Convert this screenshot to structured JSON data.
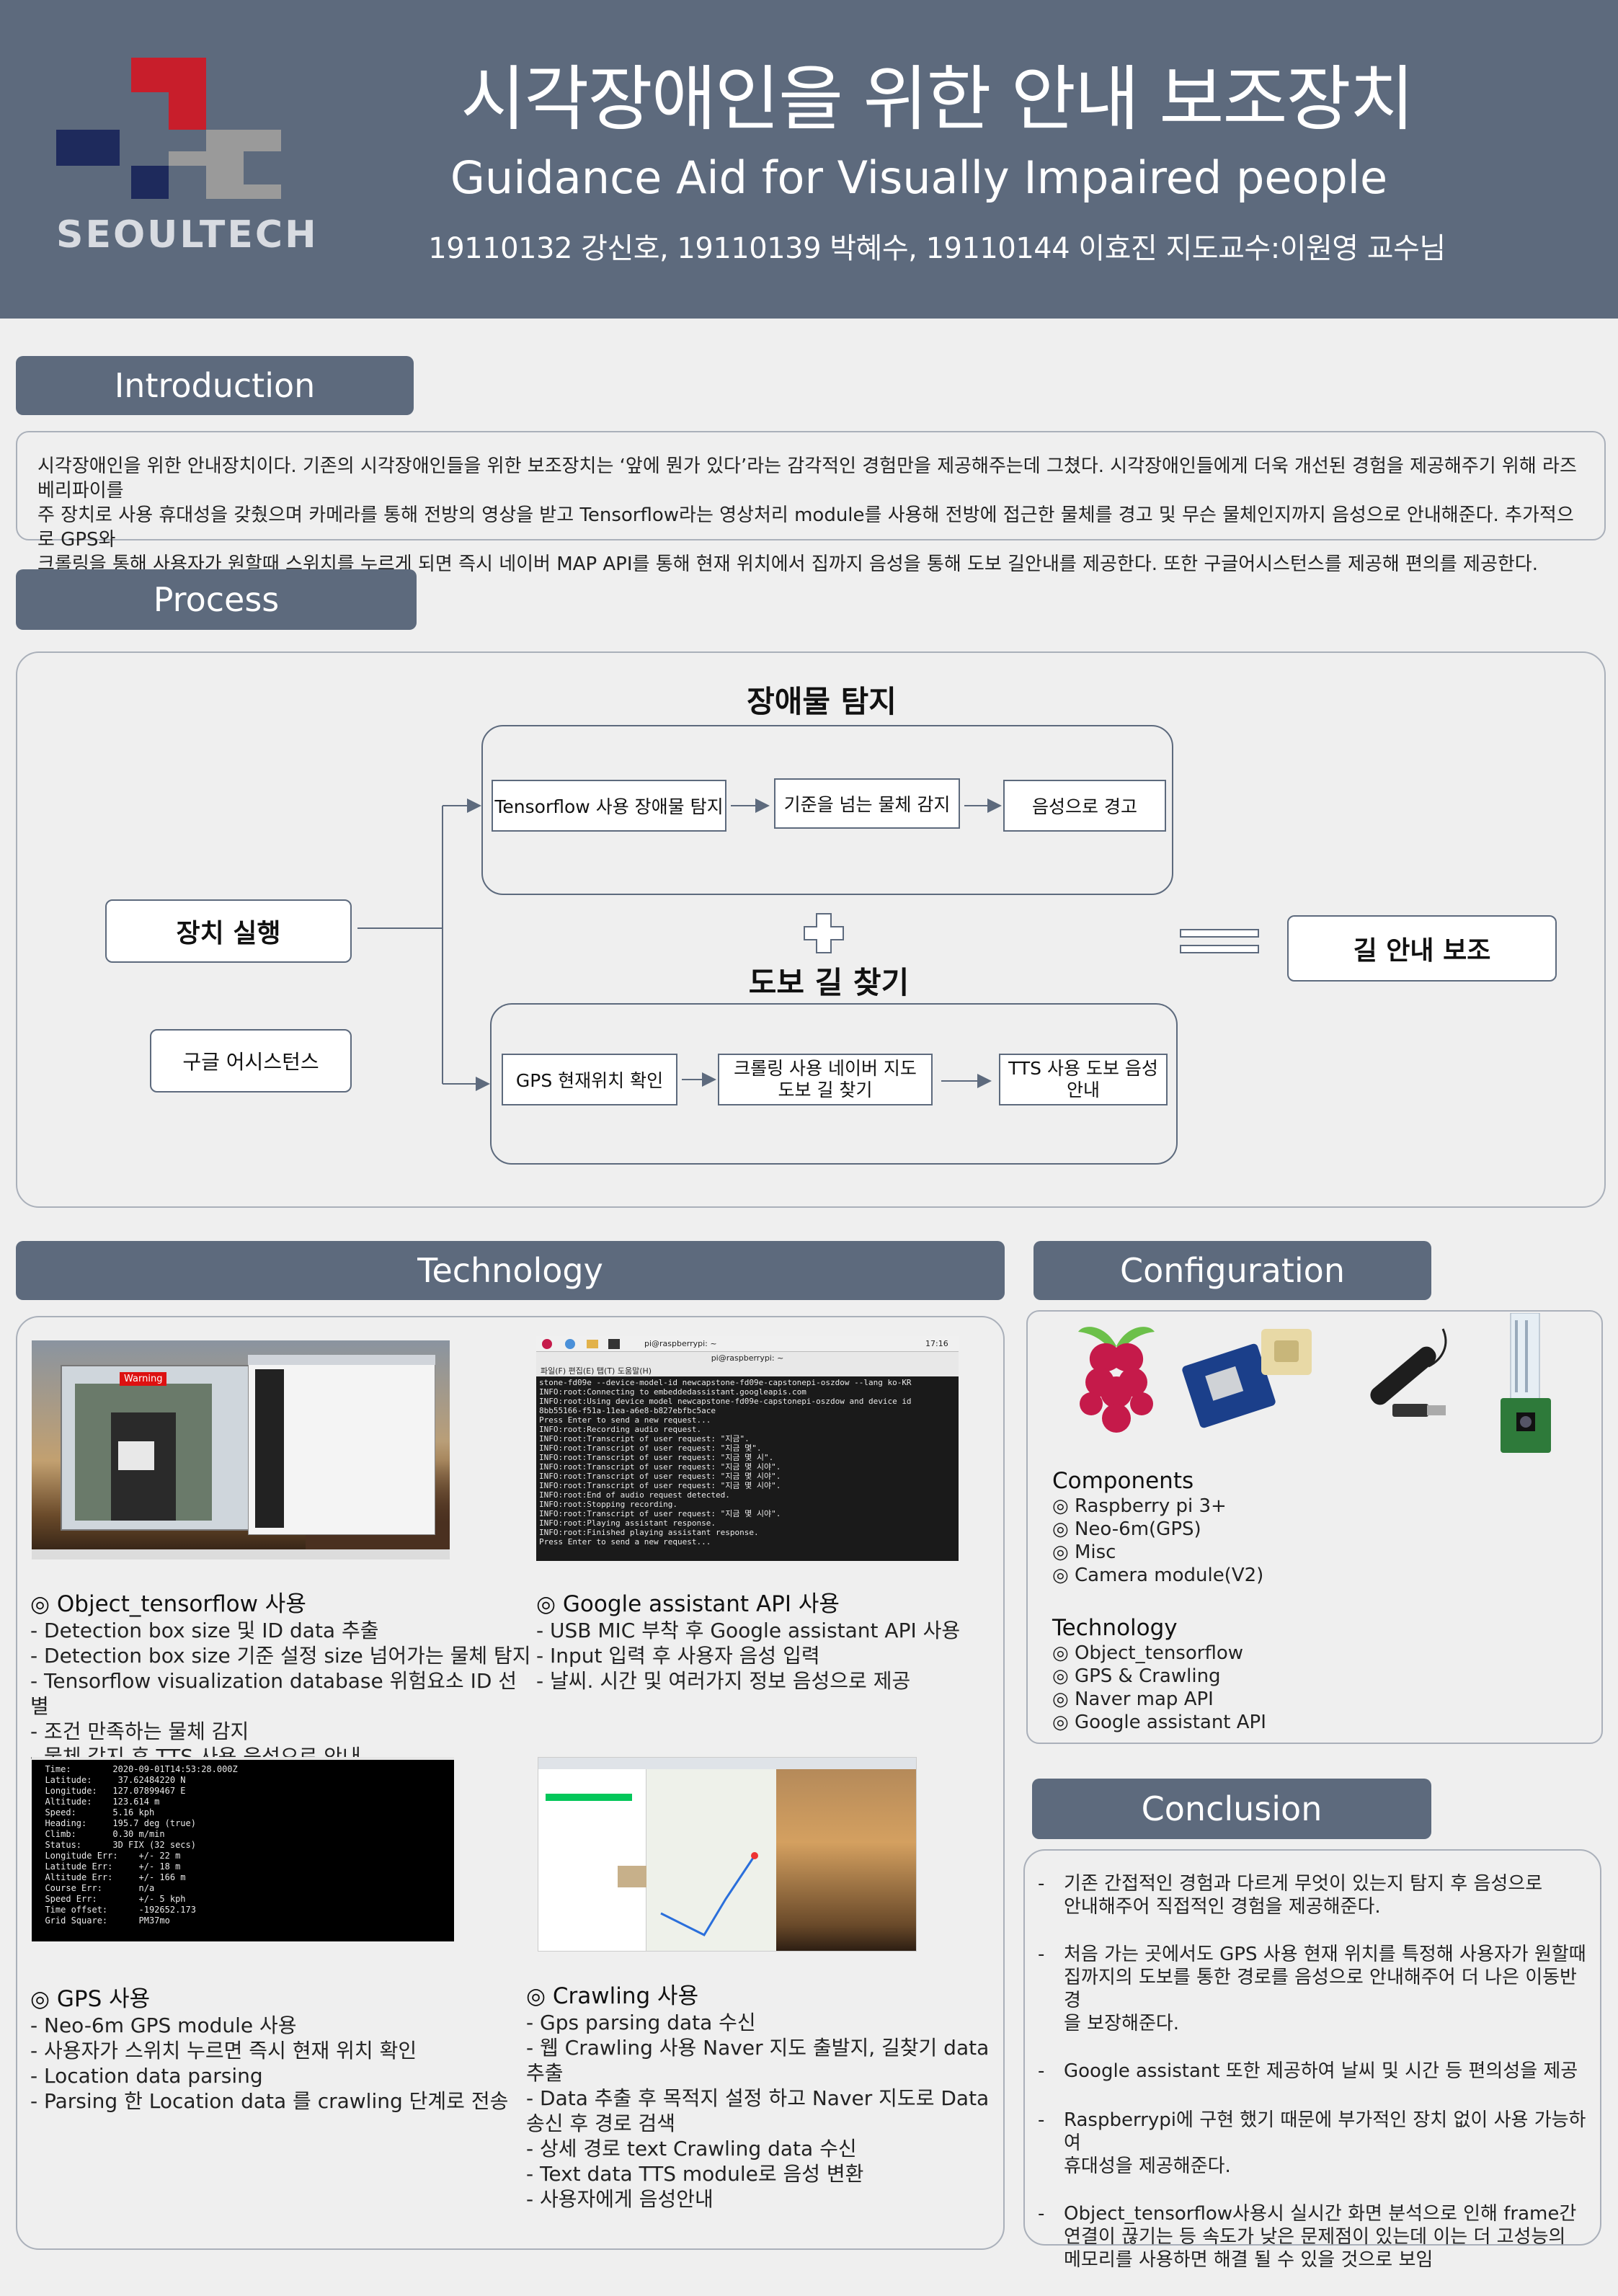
{
  "header": {
    "title": "시각장애인을 위한  안내 보조장치",
    "subtitle": "Guidance Aid for Visually Impaired people",
    "authors": "19110132 강신호, 19110139 박혜수, 19110144 이효진   지도교수:이원영 교수님",
    "logo_text": "SEOULTECH",
    "colors": {
      "header_bg": "#5d6a7d",
      "logo_red": "#c81e2b",
      "logo_navy": "#1e2a5c",
      "logo_gray": "#9a9a9a"
    }
  },
  "introduction": {
    "heading": "Introduction",
    "lines": [
      " 시각장애인을 위한 안내장치이다. 기존의 시각장애인들을 위한 보조장치는 ‘앞에 뭔가 있다’라는 감각적인 경험만을 제공해주는데 그쳤다. 시각장애인들에게 더욱 개선된 경험을 제공해주기 위해 라즈베리파이를",
      "주 장치로 사용 휴대성을 갖췄으며 카메라를 통해 전방의 영상을 받고 Tensorflow라는 영상처리 module를 사용해 전방에 접근한 물체를 경고 및 무슨 물체인지까지 음성으로 안내해준다. 추가적으로 GPS와",
      "크롤링을 통해 사용자가 원할때 스위치를 누르게 되면 즉시 네이버 MAP API를 통해 현재 위치에서 집까지 음성을 통해 도보 길안내를 제공한다. 또한 구글어시스턴스를 제공해 편의를 제공한다."
    ]
  },
  "process": {
    "heading": "Process",
    "obstacle_title": "장애물 탐지",
    "walk_title": "도보 길 찾기",
    "device_run": "장치 실행",
    "google_assistant": "구글 어시스턴스",
    "guide_assist": "길 안내 보조",
    "top_steps": [
      "Tensorflow 사용 장애물 탐지",
      "기준을 넘는 물체 감지",
      "음성으로 경고"
    ],
    "bottom_steps": [
      "GPS 현재위치 확인",
      "크롤링 사용 네이버 지도\n도보 길 찾기",
      "TTS 사용 도보 음성\n안내"
    ]
  },
  "technology": {
    "heading": "Technology",
    "object": {
      "title": "◎ Object_tensorflow 사용",
      "items": [
        "- Detection box size 및 ID data 추출",
        "- Detection box size 기준 설정 size 넘어가는 물체 탐지",
        "- Tensorflow visualization database 위험요소 ID 선별",
        "- 조건 만족하는 물체 감지",
        "- 물체 감지 후 TTS 사용 음성으로 안내"
      ]
    },
    "assistant": {
      "title": "◎ Google assistant API 사용",
      "items": [
        "- USB MIC 부착 후 Google assistant API 사용",
        "- Input 입력 후 사용자 음성 입력",
        "- 날씨. 시간 및 여러가지 정보 음성으로 제공"
      ]
    },
    "gps": {
      "title": "◎ GPS 사용",
      "items": [
        "- Neo-6m GPS module 사용",
        "- 사용자가 스위치 누르면 즉시 현재 위치 확인",
        "- Location data parsing",
        "- Parsing 한 Location data 를 crawling 단계로 전송"
      ]
    },
    "crawling": {
      "title": "◎ Crawling 사용",
      "items": [
        "- Gps parsing data 수신",
        "- 웹 Crawling 사용 Naver 지도 출발지, 길찾기 data",
        "추출",
        "- Data 추출 후  목적지 설정 하고 Naver 지도로 Data",
        "송신 후 경로 검색",
        "- 상세 경로 text Crawling data 수신",
        "- Text data TTS module로 음성 변환",
        "- 사용자에게 음성안내"
      ]
    },
    "screenshots": {
      "warning_label": "Warning",
      "terminal_title": "pi@raspberrypi: ~",
      "terminal_menu": "파일(F)   편집(E)   탭(T)   도움말(H)",
      "terminal_time": "17:16",
      "terminal_lines": [
        "stone-fd09e --device-model-id newcapstone-fd09e-capstonepi-oszdow --lang ko-KR",
        "INFO:root:Connecting to embeddedassistant.googleapis.com",
        "INFO:root:Using device model newcapstone-fd09e-capstonepi-oszdow and device id",
        "8bb55166-f51a-11ea-a6e8-b827ebfbc5ace",
        "Press Enter to send a new request...",
        "INFO:root:Recording audio request.",
        "INFO:root:Transcript of user request: \"지금\".",
        "INFO:root:Transcript of user request: \"지금 몇\".",
        "INFO:root:Transcript of user request: \"지금 몇 시\".",
        "INFO:root:Transcript of user request: \"지금 몇 시야\".",
        "INFO:root:Transcript of user request: \"지금 몇 시야\".",
        "INFO:root:Transcript of user request: \"지금 몇 시야\".",
        "INFO:root:End of audio request detected.",
        "INFO:root:Stopping recording.",
        "INFO:root:Transcript of user request: \"지금 몇 시야\".",
        "INFO:root:Playing assistant response.",
        "INFO:root:Finished playing assistant response.",
        "Press Enter to send a new request..."
      ],
      "gps_lines": [
        "  Time:        2020-09-01T14:53:28.000Z",
        "  Latitude:     37.62484220 N",
        "  Longitude:   127.07899467 E",
        "  Altitude:    123.614 m",
        "  Speed:       5.16 kph",
        "  Heading:     195.7 deg (true)",
        "  Climb:       0.30 m/min",
        "  Status:      3D FIX (32 secs)",
        "  Longitude Err:    +/- 22 m",
        "  Latitude Err:     +/- 18 m",
        "  Altitude Err:     +/- 166 m",
        "  Course Err:       n/a",
        "  Speed Err:        +/- 5 kph",
        "  Time offset:      -192652.173",
        "  Grid Square:      PM37mo"
      ]
    }
  },
  "configuration": {
    "heading": "Configuration",
    "components_title": "Components",
    "components": [
      "◎ Raspberry pi 3+",
      "◎ Neo-6m(GPS)",
      "◎ Misc",
      "◎ Camera module(V2)"
    ],
    "technology_title": "Technology",
    "technology": [
      "◎ Object_tensorflow",
      "◎ GPS & Crawling",
      "◎ Naver map API",
      "◎ Google assistant API"
    ]
  },
  "conclusion": {
    "heading": "Conclusion",
    "items": [
      {
        "marker": "-",
        "lines": [
          "기존 간접적인 경험과 다르게 무엇이 있는지 탐지 후 음성으로",
          "안내해주어 직접적인 경험을 제공해준다."
        ]
      },
      {
        "marker": "-",
        "lines": [
          "처음 가는 곳에서도 GPS 사용 현재 위치를 특정해 사용자가 원할때",
          "집까지의 도보를 통한 경로를 음성으로 안내해주어 더 나은 이동반경",
          "을 보장해준다."
        ]
      },
      {
        "marker": "-",
        "lines": [
          "Google assistant 또한 제공하여 날씨 및 시간 등 편의성을 제공"
        ]
      },
      {
        "marker": "-",
        "lines": [
          "Raspberrypi에 구현 했기 때문에 부가적인 장치 없이 사용 가능하여",
          "휴대성을 제공해준다."
        ]
      },
      {
        "marker": "-",
        "lines": [
          "Object_tensorflow사용시 실시간 화면 분석으로 인해 frame간",
          "연결이 끊기는 등 속도가 낮은 문제점이 있는데 이는 더 고성능의",
          "메모리를 사용하면 해결 될 수 있을 것으로 보임"
        ]
      }
    ]
  }
}
